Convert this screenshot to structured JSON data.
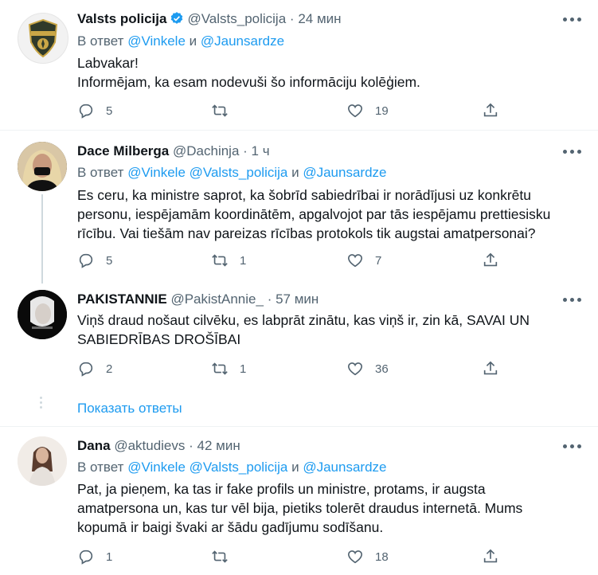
{
  "tweets": [
    {
      "name": "Valsts policija",
      "verified": true,
      "handle": "@Valsts_policija",
      "dot": "·",
      "time": "24 мин",
      "reply_prefix": "В ответ",
      "reply_mentions": [
        "@Vinkele",
        "@Jaunsardze"
      ],
      "reply_joiner": "и",
      "lines": [
        "Labvakar!",
        "Informējam, ka esam nodevuši šo informāciju kolēģiem."
      ],
      "replies": "5",
      "retweets": "",
      "likes": "19"
    },
    {
      "name": "Dace Milberga",
      "handle": "@Dachinja",
      "dot": "·",
      "time": "1 ч",
      "reply_prefix": "В ответ",
      "reply_mentions": [
        "@Vinkele",
        "@Valsts_policija",
        "@Jaunsardze"
      ],
      "reply_joiner": "и",
      "lines": [
        "Es ceru, ka ministre saprot, ka šobrīd sabiedrībai ir norādījusi uz konkrētu",
        "personu, iespējamām koordinātēm, apgalvojot par tās iespējamu prettiesisku",
        "rīcību. Vai tiešām nav pareizas rīcības protokols tik augstai amatpersonai?"
      ],
      "replies": "5",
      "retweets": "1",
      "likes": "7"
    },
    {
      "name": "PAKISTANNIE",
      "handle": "@PakistAnnie_",
      "dot": "·",
      "time": "57 мин",
      "lines": [
        "Viņš draud nošaut cilvēku, es labprāt zinātu, kas viņš ir, zin kā, SAVAI UN",
        "SABIEDRĪBAS DROŠĪBAI"
      ],
      "replies": "2",
      "retweets": "1",
      "likes": "36"
    },
    {
      "name": "Dana",
      "handle": "@aktudievs",
      "dot": "·",
      "time": "42 мин",
      "reply_prefix": "В ответ",
      "reply_mentions": [
        "@Vinkele",
        "@Valsts_policija",
        "@Jaunsardze"
      ],
      "reply_joiner": "и",
      "lines": [
        "Pat, ja pieņem, ka tas ir fake profils un ministre, protams, ir augsta",
        "amatpersona un, kas tur vēl bija, pietiks tolerēt draudus internetā. Mums",
        "kopumā ir baigi švaki ar šādu gadījumu sodīšanu."
      ],
      "replies": "1",
      "retweets": "",
      "likes": "18"
    }
  ],
  "show_replies_label": "Показать ответы",
  "icons": {
    "reply": "reply-icon",
    "retweet": "retweet-icon",
    "like": "heart-icon",
    "share": "share-icon",
    "more": "more-icon",
    "verified": "verified-badge-icon"
  },
  "colors": {
    "accent": "#1d9bf0",
    "secondary_text": "#536471",
    "primary_text": "#0f1419",
    "separator": "#eff3f4"
  }
}
